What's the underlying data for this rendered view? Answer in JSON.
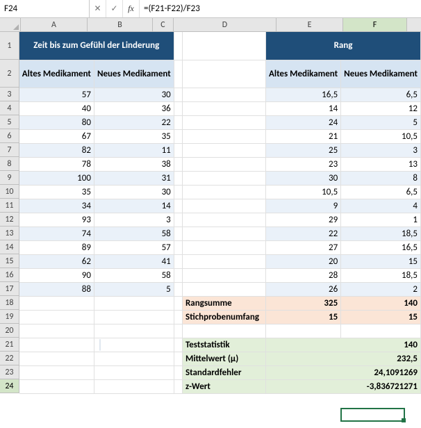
{
  "formula_bar": {
    "cell_ref": "F24",
    "cancel": "✕",
    "commit": "✓",
    "fx": "fx",
    "formula": "=(F21-F22)/F23"
  },
  "columns": [
    "A",
    "B",
    "C",
    "D",
    "E",
    "F"
  ],
  "rows": [
    "1",
    "2",
    "3",
    "4",
    "5",
    "6",
    "7",
    "8",
    "9",
    "10",
    "11",
    "12",
    "13",
    "14",
    "15",
    "16",
    "17",
    "18",
    "19",
    "20",
    "21",
    "22",
    "23",
    "24"
  ],
  "left_table": {
    "title": "Zeit bis zum Gefühl der Linderung",
    "col_a": "Altes Medikament",
    "col_b": "Neues Medikament",
    "data": [
      {
        "a": "57",
        "b": "30"
      },
      {
        "a": "40",
        "b": "36"
      },
      {
        "a": "80",
        "b": "22"
      },
      {
        "a": "67",
        "b": "35"
      },
      {
        "a": "82",
        "b": "11"
      },
      {
        "a": "78",
        "b": "38"
      },
      {
        "a": "100",
        "b": "31"
      },
      {
        "a": "35",
        "b": "30"
      },
      {
        "a": "34",
        "b": "14"
      },
      {
        "a": "93",
        "b": "3"
      },
      {
        "a": "74",
        "b": "58"
      },
      {
        "a": "89",
        "b": "57"
      },
      {
        "a": "62",
        "b": "41"
      },
      {
        "a": "90",
        "b": "58"
      },
      {
        "a": "88",
        "b": "5"
      }
    ]
  },
  "right_table": {
    "title": "Rang",
    "col_e": "Altes Medikament",
    "col_f": "Neues Medikament",
    "data": [
      {
        "e": "16,5",
        "f": "6,5"
      },
      {
        "e": "14",
        "f": "12"
      },
      {
        "e": "24",
        "f": "5"
      },
      {
        "e": "21",
        "f": "10,5"
      },
      {
        "e": "25",
        "f": "3"
      },
      {
        "e": "23",
        "f": "13"
      },
      {
        "e": "30",
        "f": "8"
      },
      {
        "e": "10,5",
        "f": "6,5"
      },
      {
        "e": "9",
        "f": "4"
      },
      {
        "e": "29",
        "f": "1"
      },
      {
        "e": "22",
        "f": "18,5"
      },
      {
        "e": "27",
        "f": "16,5"
      },
      {
        "e": "20",
        "f": "15"
      },
      {
        "e": "28",
        "f": "18,5"
      },
      {
        "e": "26",
        "f": "2"
      }
    ]
  },
  "summary": {
    "rangsumme_label": "Rangsumme",
    "rangsumme_e": "325",
    "rangsumme_f": "140",
    "stich_label": "Stichprobenumfang",
    "stich_e": "15",
    "stich_f": "15"
  },
  "stats": {
    "teststat_label": "Teststatistik",
    "teststat_val": "140",
    "mittel_label": "Mittelwert (μ)",
    "mittel_val": "232,5",
    "stderr_label": "Standardfehler",
    "stderr_val": "24,1091269",
    "z_label": "z-Wert",
    "z_val": "-3,836721271"
  },
  "active_cell": "F24"
}
